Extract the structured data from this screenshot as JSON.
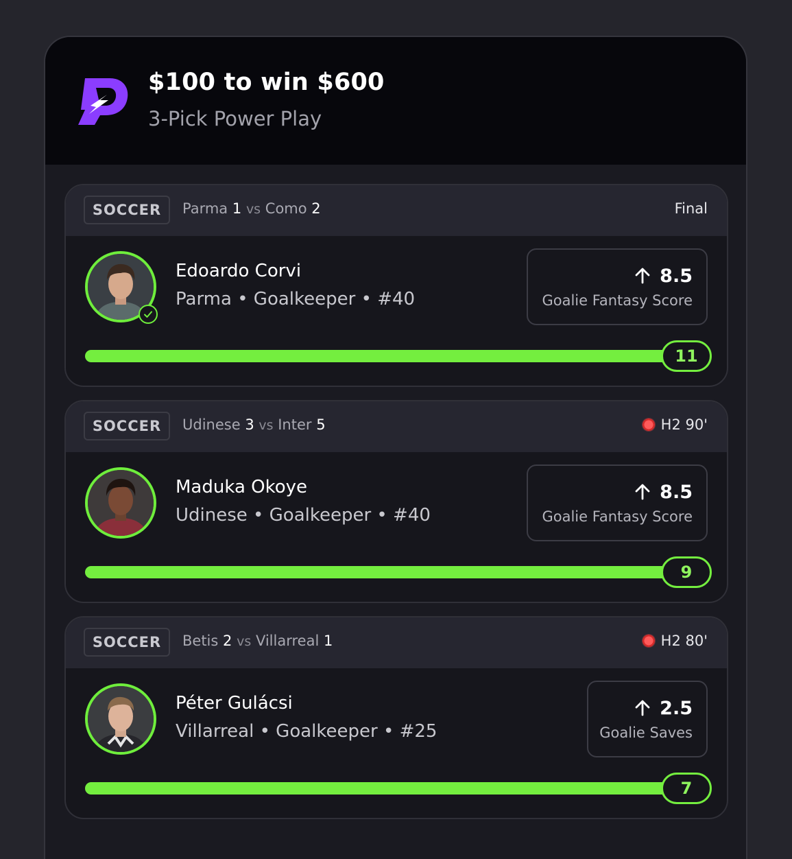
{
  "header": {
    "title": "$100 to win $600",
    "subtitle": "3-Pick Power Play",
    "logo_icon": "power-play-logo"
  },
  "colors": {
    "accent_green": "#74ee3f",
    "live_red": "#ff4b4b",
    "logo_purple": "#8b3dff"
  },
  "picks": [
    {
      "sport": "SOCCER",
      "home_team": "Parma",
      "home_score": "1",
      "vs": "vs",
      "away_team": "Como",
      "away_score": "2",
      "status": "Final",
      "live": false,
      "player_name": "Edoardo Corvi",
      "player_info": "Parma • Goalkeeper • #40",
      "completed": true,
      "direction_icon": "arrow-up-icon",
      "line": "8.5",
      "stat": "Goalie Fantasy Score",
      "current": "11",
      "progress": 1.0
    },
    {
      "sport": "SOCCER",
      "home_team": "Udinese",
      "home_score": "3",
      "vs": "vs",
      "away_team": "Inter",
      "away_score": "5",
      "status": "H2 90'",
      "live": true,
      "player_name": "Maduka Okoye",
      "player_info": "Udinese • Goalkeeper • #40",
      "completed": false,
      "direction_icon": "arrow-up-icon",
      "line": "8.5",
      "stat": "Goalie Fantasy Score",
      "current": "9",
      "progress": 1.0
    },
    {
      "sport": "SOCCER",
      "home_team": "Betis",
      "home_score": "2",
      "vs": "vs",
      "away_team": "Villarreal",
      "away_score": "1",
      "status": "H2 80'",
      "live": true,
      "player_name": "Péter Gulácsi",
      "player_info": "Villarreal • Goalkeeper • #25",
      "completed": false,
      "direction_icon": "arrow-up-icon",
      "line": "2.5",
      "stat": "Goalie Saves",
      "current": "7",
      "progress": 1.0
    }
  ]
}
